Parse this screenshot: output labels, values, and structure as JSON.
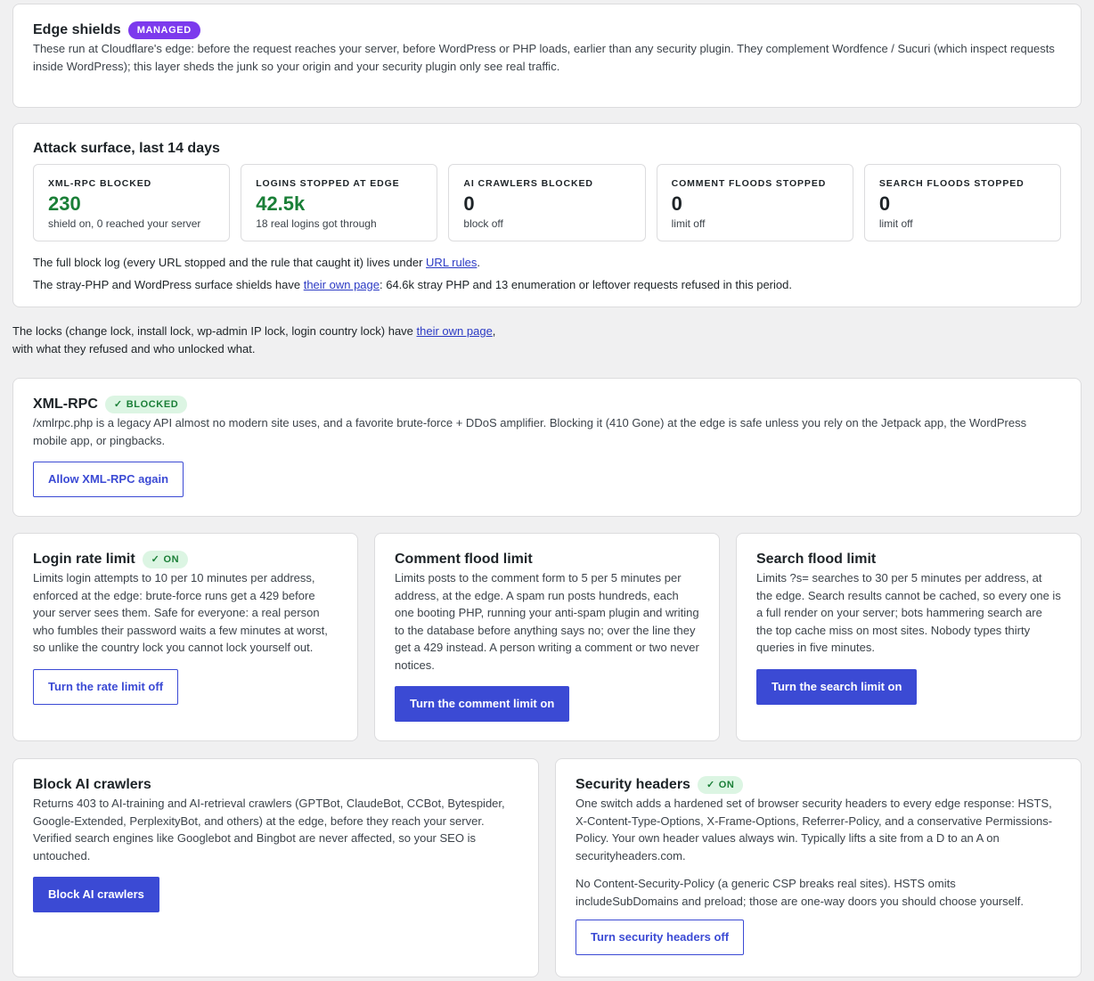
{
  "edge": {
    "title": "Edge shields",
    "badge": "MANAGED",
    "desc": "These run at Cloudflare's edge: before the request reaches your server, before WordPress or PHP loads, earlier than any security plugin. They complement Wordfence / Sucuri (which inspect requests inside WordPress); this layer sheds the junk so your origin and your security plugin only see real traffic."
  },
  "attack": {
    "title": "Attack surface, last 14 days",
    "stats": [
      {
        "label": "XML-RPC BLOCKED",
        "value": "230",
        "sub": "shield on, 0 reached your server"
      },
      {
        "label": "LOGINS STOPPED AT EDGE",
        "value": "42.5k",
        "sub": "18 real logins got through"
      },
      {
        "label": "AI CRAWLERS BLOCKED",
        "value": "0",
        "sub": "block off"
      },
      {
        "label": "COMMENT FLOODS STOPPED",
        "value": "0",
        "sub": "limit off"
      },
      {
        "label": "SEARCH FLOODS STOPPED",
        "value": "0",
        "sub": "limit off"
      }
    ],
    "note1_pre": "The full block log (every URL stopped and the rule that caught it) lives under ",
    "note1_link": "URL rules",
    "note1_post": ".",
    "note2_pre": "The stray-PHP and WordPress surface shields have ",
    "note2_link": "their own page",
    "note2_post": ": 64.6k stray PHP and 13 enumeration or leftover requests refused in this period."
  },
  "locks": {
    "pre": "The locks (change lock, install lock, wp-admin IP lock, login country lock) have ",
    "link": "their own page",
    "post": ",",
    "line2": "with what they refused and who unlocked what."
  },
  "xmlrpc": {
    "title": "XML-RPC",
    "badge": "BLOCKED",
    "desc": "/xmlrpc.php is a legacy API almost no modern site uses, and a favorite brute-force + DDoS amplifier. Blocking it (410 Gone) at the edge is safe unless you rely on the Jetpack app, the WordPress mobile app, or pingbacks.",
    "button": "Allow XML-RPC again"
  },
  "login": {
    "title": "Login rate limit",
    "badge": "ON",
    "desc": "Limits login attempts to 10 per 10 minutes per address, enforced at the edge: brute-force runs get a 429 before your server sees them. Safe for everyone: a real person who fumbles their password waits a few minutes at worst, so unlike the country lock you cannot lock yourself out.",
    "button": "Turn the rate limit off"
  },
  "comment": {
    "title": "Comment flood limit",
    "desc": "Limits posts to the comment form to 5 per 5 minutes per address, at the edge. A spam run posts hundreds, each one booting PHP, running your anti-spam plugin and writing to the database before anything says no; over the line they get a 429 instead. A person writing a comment or two never notices.",
    "button": "Turn the comment limit on"
  },
  "search": {
    "title": "Search flood limit",
    "desc": "Limits ?s= searches to 30 per 5 minutes per address, at the edge. Search results cannot be cached, so every one is a full render on your server; bots hammering search are the top cache miss on most sites. Nobody types thirty queries in five minutes.",
    "button": "Turn the search limit on"
  },
  "ai": {
    "title": "Block AI crawlers",
    "desc": "Returns 403 to AI-training and AI-retrieval crawlers (GPTBot, ClaudeBot, CCBot, Bytespider, Google-Extended, PerplexityBot, and others) at the edge, before they reach your server. Verified search engines like Googlebot and Bingbot are never affected, so your SEO is untouched.",
    "button": "Block AI crawlers"
  },
  "headers": {
    "title": "Security headers",
    "badge": "ON",
    "desc1": "One switch adds a hardened set of browser security headers to every edge response: HSTS, X-Content-Type-Options, X-Frame-Options, Referrer-Policy, and a conservative Permissions-Policy. Your own header values always win. Typically lifts a site from a D to an A on securityheaders.com.",
    "desc2": "No Content-Security-Policy (a generic CSP breaks real sites). HSTS omits includeSubDomains and preload; those are one-way doors you should choose yourself.",
    "button": "Turn security headers off"
  },
  "colors": {
    "accent": "#3b4ad4",
    "managed": "#7c3aed",
    "green": "#1a7f37",
    "green_bg": "#dcf5e3"
  }
}
